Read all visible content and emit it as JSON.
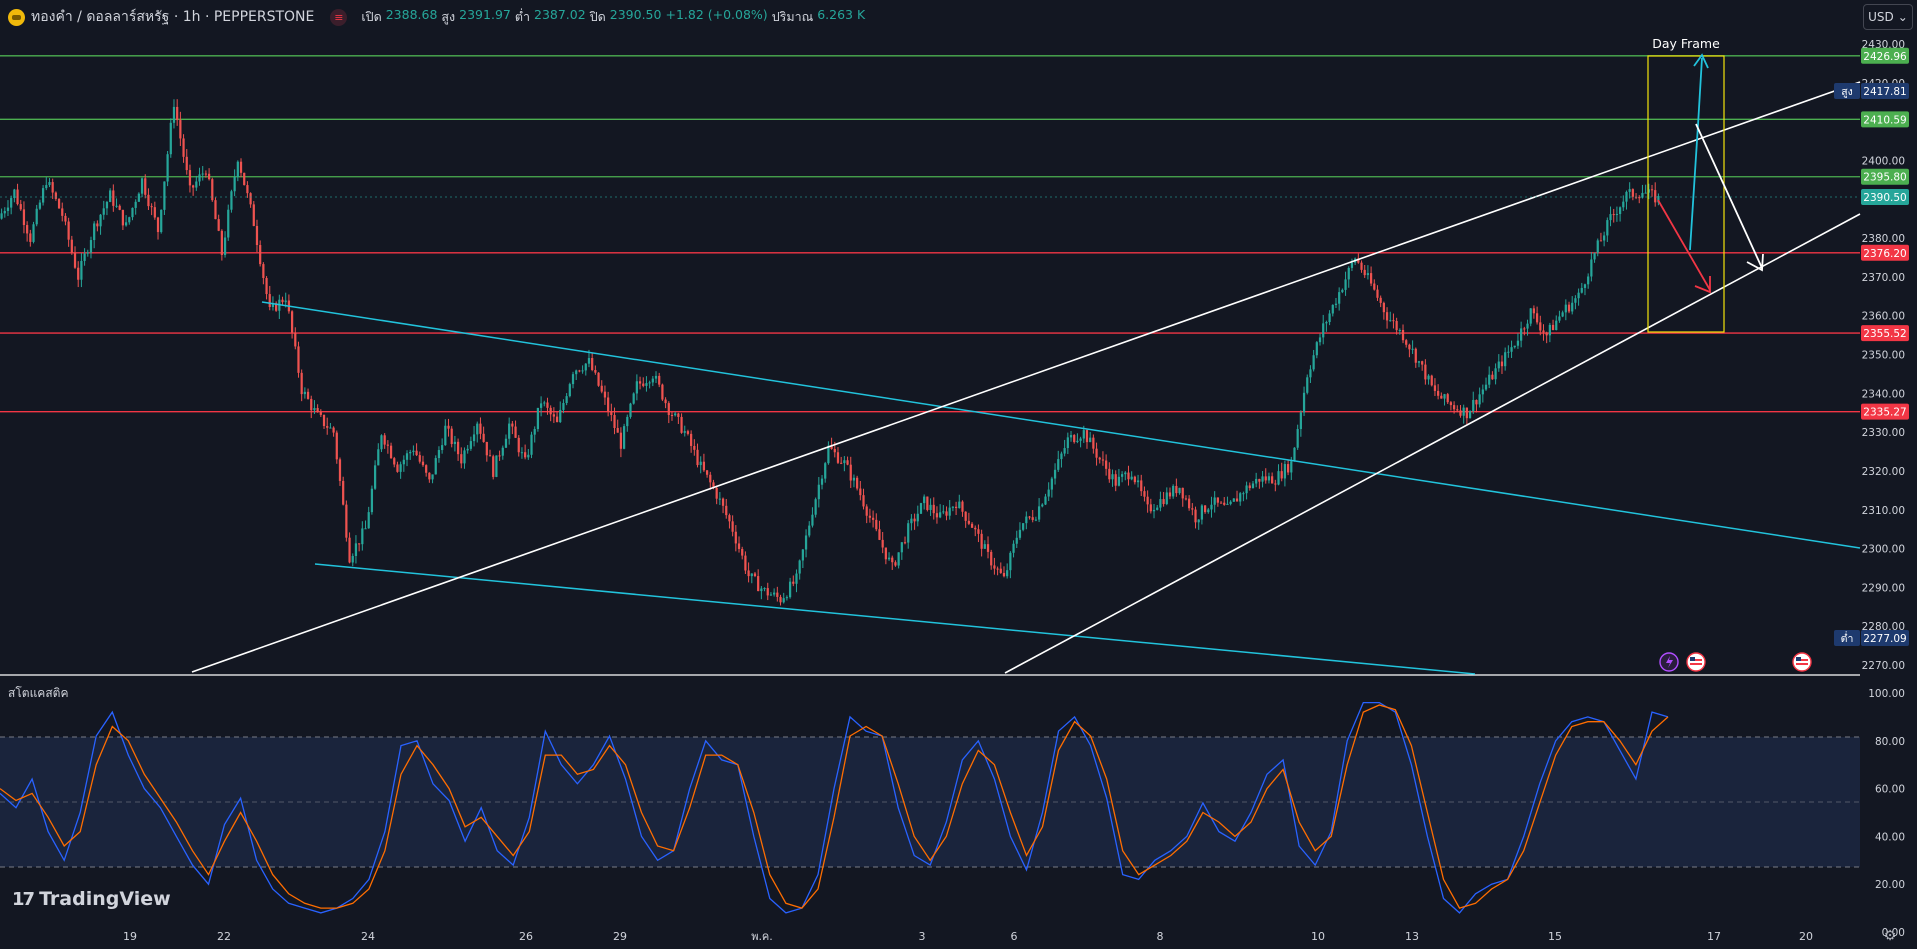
{
  "header": {
    "title": "ทองคำ / ดอลลาร์สหรัฐ · 1h · PEPPERSTONE",
    "badge": "≡",
    "ohlc": {
      "open_label": "เปิด",
      "open": "2388.68",
      "high_label": "สูง",
      "high": "2391.97",
      "low_label": "ต่ำ",
      "low": "2387.02",
      "close_label": "ปิด",
      "close": "2390.50",
      "change": "+1.82 (+0.08%)",
      "volume_label": "ปริมาณ",
      "volume": "6.263 K"
    }
  },
  "currency": {
    "value": "USD",
    "arrow": "⌄"
  },
  "price_axis": {
    "ticks": [
      "2430.00",
      "2420.00",
      "2400.00",
      "2390.00",
      "2380.00",
      "2370.00",
      "2360.00",
      "2350.00",
      "2340.00",
      "2330.00",
      "2320.00",
      "2310.00",
      "2300.00",
      "2290.00",
      "2280.00",
      "2270.00"
    ],
    "high_tag": {
      "label": "สูง",
      "value": "2417.81"
    },
    "low_tag": {
      "label": "ต่ำ",
      "value": "2277.09"
    }
  },
  "levels": [
    {
      "value": "2426.96",
      "kind": "support-green"
    },
    {
      "value": "2410.59",
      "kind": "support-green"
    },
    {
      "value": "2395.80",
      "kind": "support-green"
    },
    {
      "value": "2376.20",
      "kind": "resistance-red"
    },
    {
      "value": "2355.52",
      "kind": "resistance-red"
    },
    {
      "value": "2335.27",
      "kind": "resistance-red"
    }
  ],
  "last_price": "2390.50",
  "annotation": {
    "label": "Day Frame"
  },
  "time_axis": [
    "19",
    "22",
    "24",
    "26",
    "29",
    "พ.ค.",
    "3",
    "6",
    "8",
    "10",
    "13",
    "15",
    "17",
    "20"
  ],
  "oscillator": {
    "name": "สโตแคสติค",
    "ticks": [
      "100.00",
      "80.00",
      "60.00",
      "40.00",
      "20.00",
      "0.00"
    ],
    "band": [
      20,
      80
    ]
  },
  "colors": {
    "background": "#131722",
    "up": "#26a69a",
    "down": "#ef5350",
    "green_level": "#4caf50",
    "red_level": "#f23645",
    "channel": "#22c3dc",
    "trend": "#ffffff",
    "k_line": "#2962ff",
    "d_line": "#ff6d00",
    "frame": "#f5e50a"
  },
  "icons": [
    "lightning-event-icon",
    "us-flag-event-icon",
    "us-flag-event-icon",
    "settings-icon"
  ],
  "branding": {
    "text": "TradingView",
    "logo": "17"
  },
  "chart_data": {
    "type": "candlestick",
    "title": "ทองคำ / ดอลลาร์สหรัฐ · 1h · PEPPERSTONE",
    "ylim": [
      2267,
      2433
    ],
    "price_path": [
      2385,
      2392,
      2380,
      2395,
      2386,
      2370,
      2383,
      2391,
      2383,
      2395,
      2382,
      2415,
      2392,
      2398,
      2376,
      2401,
      2384,
      2361,
      2365,
      2341,
      2334,
      2330,
      2298,
      2305,
      2330,
      2321,
      2326,
      2317,
      2331,
      2323,
      2333,
      2320,
      2332,
      2322,
      2338,
      2332,
      2346,
      2348,
      2338,
      2327,
      2342,
      2345,
      2336,
      2330,
      2321,
      2314,
      2305,
      2293,
      2289,
      2287,
      2292,
      2310,
      2326,
      2322,
      2314,
      2304,
      2295,
      2305,
      2312,
      2308,
      2312,
      2306,
      2298,
      2292,
      2306,
      2309,
      2318,
      2328,
      2330,
      2323,
      2317,
      2320,
      2310,
      2313,
      2316,
      2308,
      2312,
      2310,
      2315,
      2318,
      2318,
      2322,
      2345,
      2357,
      2366,
      2375,
      2368,
      2360,
      2355,
      2348,
      2340,
      2337,
      2335,
      2341,
      2347,
      2353,
      2361,
      2355,
      2361,
      2365,
      2376,
      2385,
      2391,
      2392,
      2390
    ],
    "oscillator_k": [
      58,
      52,
      64,
      42,
      30,
      50,
      82,
      92,
      74,
      60,
      52,
      40,
      28,
      20,
      45,
      56,
      30,
      18,
      12,
      10,
      8,
      10,
      14,
      22,
      42,
      78,
      80,
      62,
      55,
      38,
      52,
      34,
      28,
      48,
      84,
      70,
      62,
      70,
      82,
      64,
      40,
      30,
      34,
      60,
      80,
      72,
      70,
      40,
      14,
      8,
      10,
      24,
      60,
      90,
      84,
      82,
      52,
      32,
      28,
      46,
      72,
      80,
      64,
      40,
      26,
      50,
      84,
      90,
      78,
      56,
      24,
      22,
      30,
      34,
      40,
      54,
      42,
      38,
      50,
      66,
      72,
      36,
      28,
      42,
      80,
      96,
      96,
      92,
      70,
      40,
      14,
      8,
      16,
      20,
      22,
      40,
      62,
      80,
      88,
      90,
      88,
      76,
      64,
      92,
      90
    ],
    "oscillator_d": [
      60,
      55,
      58,
      48,
      36,
      42,
      70,
      86,
      80,
      66,
      56,
      46,
      34,
      24,
      38,
      50,
      38,
      24,
      16,
      12,
      10,
      10,
      12,
      18,
      34,
      66,
      78,
      70,
      60,
      44,
      48,
      40,
      32,
      42,
      74,
      74,
      66,
      68,
      78,
      70,
      50,
      36,
      34,
      52,
      74,
      74,
      70,
      50,
      24,
      12,
      10,
      18,
      48,
      82,
      86,
      82,
      62,
      40,
      30,
      40,
      62,
      76,
      70,
      50,
      32,
      44,
      76,
      88,
      82,
      64,
      34,
      24,
      28,
      32,
      38,
      50,
      46,
      40,
      46,
      60,
      68,
      46,
      34,
      40,
      70,
      92,
      95,
      93,
      78,
      50,
      22,
      10,
      12,
      18,
      22,
      34,
      54,
      74,
      86,
      88,
      88,
      80,
      70,
      84,
      90
    ]
  }
}
